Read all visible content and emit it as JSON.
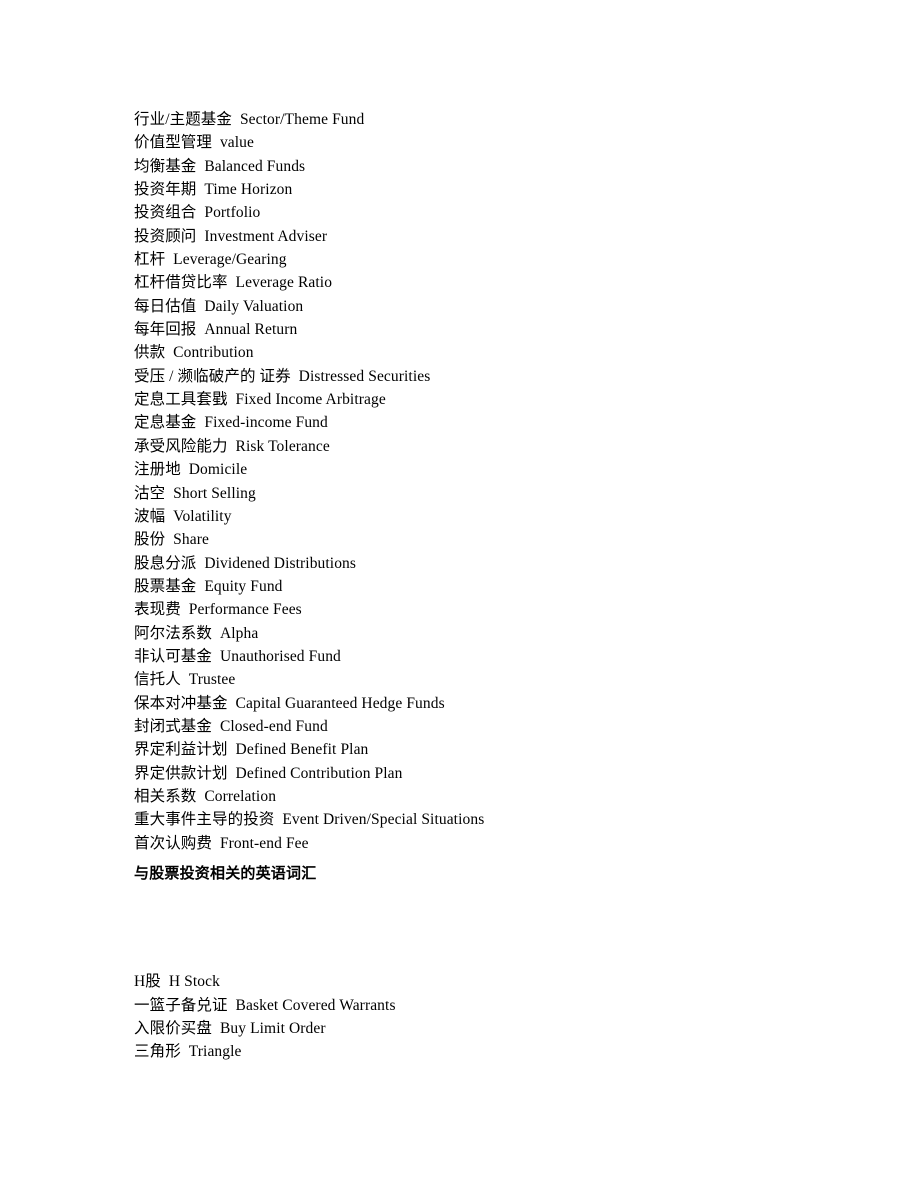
{
  "document": {
    "type": "glossary",
    "language_pair": "Chinese-English",
    "background_color": "#ffffff",
    "text_color": "#000000"
  },
  "sections": [
    {
      "id": "fund-investment-terms",
      "heading": null,
      "entries": [
        {
          "zh": "行业/主题基金",
          "en": "Sector/Theme Fund"
        },
        {
          "zh": "价值型管理",
          "en": "value"
        },
        {
          "zh": "均衡基金",
          "en": "Balanced Funds"
        },
        {
          "zh": "投资年期",
          "en": "Time Horizon"
        },
        {
          "zh": "投资组合",
          "en": "Portfolio"
        },
        {
          "zh": "投资顾问",
          "en": "Investment Adviser"
        },
        {
          "zh": "杠杆",
          "en": "Leverage/Gearing"
        },
        {
          "zh": "杠杆借贷比率",
          "en": "Leverage Ratio"
        },
        {
          "zh": "每日估值",
          "en": "Daily Valuation"
        },
        {
          "zh": "每年回报",
          "en": "Annual Return"
        },
        {
          "zh": "供款",
          "en": "Contribution"
        },
        {
          "zh": "受压 / 濒临破产的 证券",
          "en": "Distressed Securities"
        },
        {
          "zh": "定息工具套戥",
          "en": "Fixed Income Arbitrage"
        },
        {
          "zh": "定息基金",
          "en": "Fixed-income Fund"
        },
        {
          "zh": "承受风险能力",
          "en": "Risk Tolerance"
        },
        {
          "zh": "注册地",
          "en": "Domicile"
        },
        {
          "zh": "沽空",
          "en": "Short Selling"
        },
        {
          "zh": "波幅",
          "en": "Volatility"
        },
        {
          "zh": "股份",
          "en": "Share"
        },
        {
          "zh": "股息分派",
          "en": "Dividened Distributions"
        },
        {
          "zh": "股票基金",
          "en": "Equity Fund"
        },
        {
          "zh": "表现费",
          "en": "Performance Fees"
        },
        {
          "zh": "阿尔法系数",
          "en": "Alpha"
        },
        {
          "zh": "非认可基金",
          "en": "Unauthorised Fund"
        },
        {
          "zh": "信托人",
          "en": "Trustee"
        },
        {
          "zh": "保本对冲基金",
          "en": "Capital Guaranteed Hedge Funds"
        },
        {
          "zh": "封闭式基金",
          "en": "Closed-end Fund"
        },
        {
          "zh": "界定利益计划",
          "en": "Defined Benefit Plan"
        },
        {
          "zh": "界定供款计划",
          "en": "Defined Contribution Plan"
        },
        {
          "zh": "相关系数",
          "en": "Correlation"
        },
        {
          "zh": "重大事件主导的投资",
          "en": "Event Driven/Special Situations"
        },
        {
          "zh": "首次认购费",
          "en": "Front-end Fee"
        }
      ]
    },
    {
      "id": "stock-investment-terms",
      "heading": "与股票投资相关的英语词汇",
      "entries": [
        {
          "zh": "H股",
          "en": "H Stock"
        },
        {
          "zh": "一篮子备兑证",
          "en": "Basket Covered Warrants"
        },
        {
          "zh": "入限价买盘",
          "en": "Buy Limit Order"
        },
        {
          "zh": "三角形",
          "en": "Triangle"
        }
      ]
    }
  ]
}
